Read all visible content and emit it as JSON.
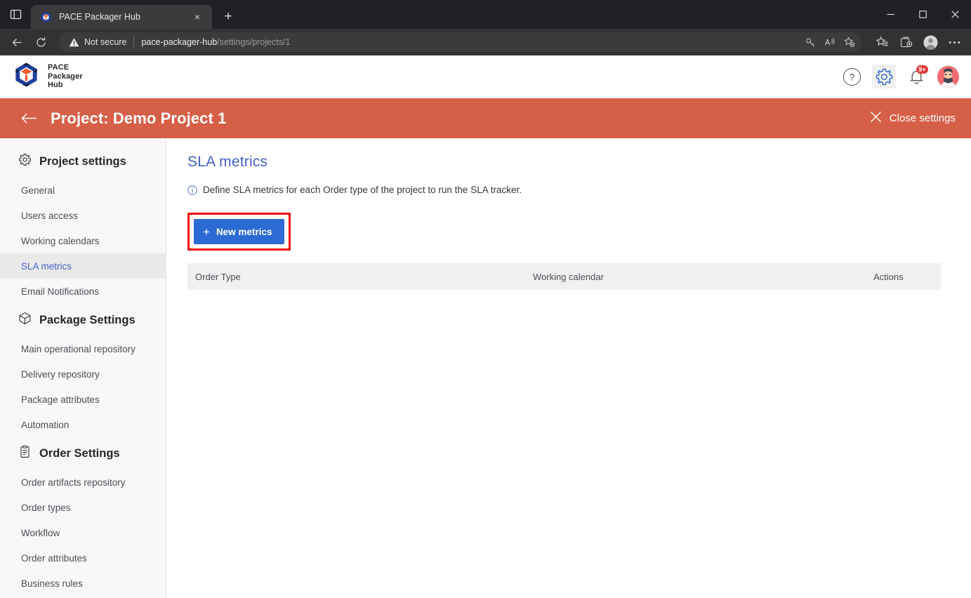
{
  "browser": {
    "tab": {
      "title": "PACE Packager Hub",
      "favicon": "pace-cube-icon",
      "close_label": "×"
    },
    "new_tab_label": "+",
    "tab_strip_icon": "tab-list-icon",
    "window_controls": {
      "minimize": "–",
      "maximize": "□",
      "close": "✕"
    },
    "nav": {
      "back": "back-arrow-icon",
      "reload": "reload-icon"
    },
    "omnibox": {
      "security_label": "Not secure",
      "security_icon": "warning-triangle-icon",
      "url_host": "pace-packager-hub",
      "url_path": "/settings/projects/1",
      "inline_icons": [
        "key-icon",
        "read-aloud-icon",
        "add-favorite-icon"
      ]
    },
    "toolbar_right_icons": [
      "favorites-icon",
      "collections-icon",
      "profile-icon",
      "settings-more-icon"
    ]
  },
  "app": {
    "logo": {
      "line1": "PACE",
      "line2": "Packager",
      "line3": "Hub",
      "icon": "pace-cube-logo"
    },
    "header_icons": {
      "help": "help-circle-icon",
      "settings": "gear-icon",
      "notifications": "bell-icon",
      "notifications_badge": "9+",
      "avatar": "user-avatar"
    }
  },
  "banner": {
    "back_icon": "arrow-left-icon",
    "title": "Project: Demo Project 1",
    "close_icon": "close-x-icon",
    "close_label": "Close settings",
    "color": "#d65f47"
  },
  "sidebar": {
    "groups": [
      {
        "label": "Project settings",
        "icon": "gear-icon",
        "items": [
          {
            "label": "General",
            "active": false
          },
          {
            "label": "Users access",
            "active": false
          },
          {
            "label": "Working calendars",
            "active": false
          },
          {
            "label": "SLA metrics",
            "active": true
          },
          {
            "label": "Email Notifications",
            "active": false
          }
        ]
      },
      {
        "label": "Package Settings",
        "icon": "package-cube-icon",
        "items": [
          {
            "label": "Main operational repository",
            "active": false
          },
          {
            "label": "Delivery repository",
            "active": false
          },
          {
            "label": "Package attributes",
            "active": false
          },
          {
            "label": "Automation",
            "active": false
          }
        ]
      },
      {
        "label": "Order Settings",
        "icon": "clipboard-icon",
        "items": [
          {
            "label": "Order artifacts repository",
            "active": false
          },
          {
            "label": "Order types",
            "active": false
          },
          {
            "label": "Workflow",
            "active": false
          },
          {
            "label": "Order attributes",
            "active": false
          },
          {
            "label": "Business rules",
            "active": false
          }
        ]
      }
    ]
  },
  "main": {
    "title": "SLA metrics",
    "info_icon": "info-circle-icon",
    "description": "Define SLA metrics for each Order type of the project to run the SLA tracker.",
    "new_button": {
      "label": "New metrics",
      "icon": "plus-icon",
      "color": "#2c6ad4",
      "highlight_color": "#f20d0d"
    },
    "table": {
      "columns": [
        "Order Type",
        "Working calendar",
        "Actions"
      ],
      "rows": []
    }
  }
}
